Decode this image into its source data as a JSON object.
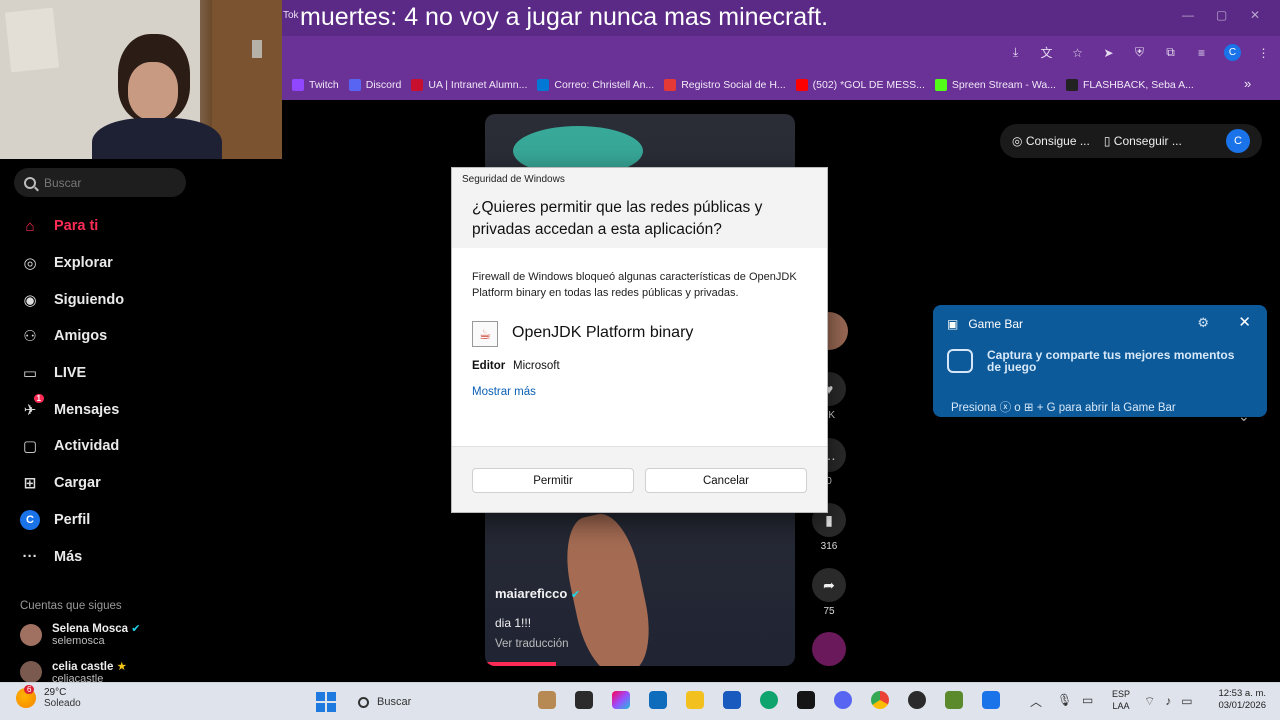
{
  "overlay_caption": "muertes: 4 no voy a jugar nunca mas minecraft.",
  "tab_title_fragment": "Tok",
  "bookmarks": [
    {
      "label": "Twitch",
      "color": "#9146ff"
    },
    {
      "label": "Discord",
      "color": "#5865f2"
    },
    {
      "label": "UA | Intranet Alumn...",
      "color": "#c8102e"
    },
    {
      "label": "Correo: Christell An...",
      "color": "#0078d4"
    },
    {
      "label": "Registro Social de H...",
      "color": "#e53935"
    },
    {
      "label": "(502) *GOL DE MESS...",
      "color": "#ff0000"
    },
    {
      "label": "Spreen Stream - Wa...",
      "color": "#53fc18"
    },
    {
      "label": "FLASHBACK, Seba A...",
      "color": "#222222"
    }
  ],
  "sidebar": {
    "search_placeholder": "Buscar",
    "items": [
      {
        "label": "Para ti",
        "icon": "home-icon",
        "glyph": "⌂",
        "active": true
      },
      {
        "label": "Explorar",
        "icon": "compass-icon",
        "glyph": "◎"
      },
      {
        "label": "Siguiendo",
        "icon": "following-icon",
        "glyph": "◉"
      },
      {
        "label": "Amigos",
        "icon": "friends-icon",
        "glyph": "⚇"
      },
      {
        "label": "LIVE",
        "icon": "live-icon",
        "glyph": "▭"
      },
      {
        "label": "Mensajes",
        "icon": "messages-icon",
        "glyph": "✈",
        "badge": "1"
      },
      {
        "label": "Actividad",
        "icon": "activity-icon",
        "glyph": "▢"
      },
      {
        "label": "Cargar",
        "icon": "upload-icon",
        "glyph": "⊞"
      },
      {
        "label": "Perfil",
        "icon": "profile-icon",
        "glyph": "C"
      },
      {
        "label": "Más",
        "icon": "more-icon",
        "glyph": "···"
      }
    ],
    "following_title": "Cuentas que sigues",
    "accounts": [
      {
        "name": "Selena Mosca",
        "handle": "selemosca",
        "verified": true
      },
      {
        "name": "celia castle",
        "handle": "celiacastle",
        "star": true
      }
    ]
  },
  "video": {
    "username": "maiarefìcco",
    "caption": "dia 1!!!",
    "translate": "Ver traducción",
    "progress": 0.23
  },
  "rail": {
    "likes": "9K",
    "comments": "0",
    "saves": "316",
    "shares": "75"
  },
  "top_buttons": {
    "get_coins": "Consigue ...",
    "get_app": "Conseguir ...",
    "avatar": "C"
  },
  "gamebar": {
    "title": "Game Bar",
    "body": "Captura y comparte tus mejores momentos de juego",
    "footer": "Presiona ⓧ o ⊞ + G para abrir la Game Bar"
  },
  "dialog": {
    "app_title": "Seguridad de Windows",
    "question": "¿Quieres permitir que las redes públicas y privadas accedan a esta aplicación?",
    "description": "Firewall de Windows bloqueó algunas características de OpenJDK Platform binary en todas las redes públicas y privadas.",
    "app_name": "OpenJDK Platform binary",
    "editor_label": "Editor",
    "editor_value": "Microsoft",
    "more_link": "Mostrar más",
    "allow_button": "Permitir",
    "cancel_button": "Cancelar"
  },
  "taskbar": {
    "weather_temp": "29°C",
    "weather_desc": "Soleado",
    "weather_badge": "6",
    "search_label": "Buscar",
    "lang_top": "ESP",
    "lang_bottom": "LAA",
    "time": "12:53 a. m.",
    "date": "03/01/2026"
  }
}
